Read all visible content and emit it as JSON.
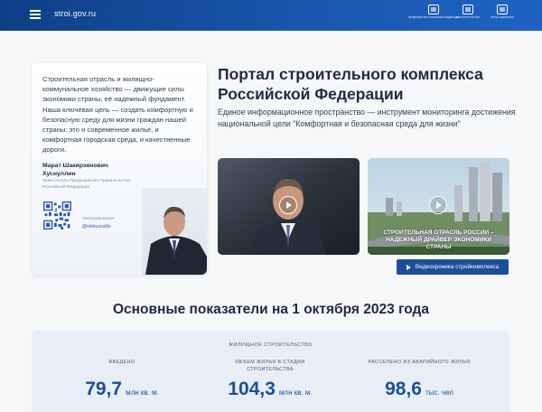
{
  "header": {
    "site_name": "stroi.gov.ru",
    "logos": [
      {
        "icon": "government-emblem-icon",
        "caption": "ПРАВИТЕЛЬСТВО РОССИЙСКОЙ ФЕДЕРАЦИИ"
      },
      {
        "icon": "minstroy-emblem-icon",
        "caption": "МИНСТРОЙ РОССИИ"
      },
      {
        "icon": "house-emblem-icon",
        "caption": "ФОНД СОДЕЙСТВИЯ"
      }
    ]
  },
  "quote": {
    "text": "Строительная отрасль и жилищно-коммунальное хозяйство — движущие силы экономики страны, её надежный фундамент. Наша ключевая цель — создать комфортную и безопасную среду для жизни граждан нашей страны: это и современное жилье, и комфортная городская среда, и качественные дороги.",
    "name": "Марат Шакирзянович Хуснуллин",
    "role": "Заместитель Председателя Правительства Российской Федерации",
    "telegram_label": "Телеграм-канал",
    "telegram_handle": "@mkhusnullin"
  },
  "portal": {
    "title": "Портал строительного комплекса Российской Федерации",
    "description": "Единое информационное пространство — инструмент мониторинга достижения национальной цели \"Комфортная и безопасная среда для жизни\""
  },
  "videos": [
    {
      "caption": ""
    },
    {
      "caption": "СТРОИТЕЛЬНАЯ ОТРАСЛЬ РОССИИ – НАДЕЖНЫЙ ДРАЙВЕР ЭКОНОМИКИ СТРАНЫ"
    }
  ],
  "chronicle_button": "Видеохроника стройкомплекса",
  "indicators": {
    "title": "Основные показатели на 1 октября 2023 года",
    "category": "ЖИЛИЩНОЕ СТРОИТЕЛЬСТВО",
    "stats": [
      {
        "label": "ВВЕДЕНО",
        "value": "79,7",
        "unit": "млн кв. м."
      },
      {
        "label": "ОБЪЕМ ЖИЛЬЯ В СТАДИИ СТРОИТЕЛЬСТВА",
        "value": "104,3",
        "unit": "млн кв. м."
      },
      {
        "label": "РАССЕЛЕНО ИЗ АВАРИЙНОГО ЖИЛЬЯ",
        "value": "98,6",
        "unit": "тыс. чел"
      }
    ]
  }
}
